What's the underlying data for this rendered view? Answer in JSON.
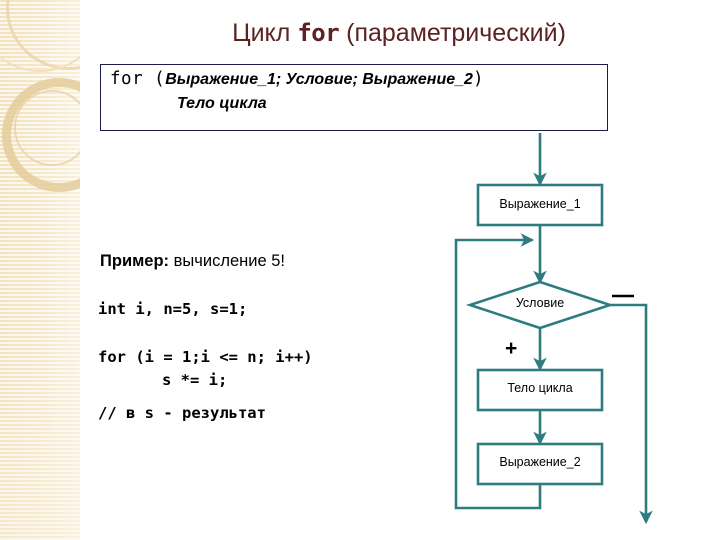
{
  "slide": {
    "title": {
      "prefix": "Цикл ",
      "keyword": "for",
      "suffix": " (параметрический)"
    },
    "syntax_box": {
      "line1_keyword": "for (",
      "line1_italic": "Выражение_1; Условие; Выражение_2",
      "line1_close": ")",
      "line2": "Тело цикла"
    },
    "example": {
      "lead": "Пример:",
      "rest": " вычисление 5!",
      "code": [
        "int i, n=5, s=1;",
        "for (i = 1;i <= n; i++)",
        "s *= i;",
        "// в s - результат"
      ]
    },
    "flowchart": {
      "nodes": [
        {
          "id": "expr1",
          "shape": "rect",
          "label": "Выражение_1"
        },
        {
          "id": "cond",
          "shape": "diamond",
          "label": "Условие"
        },
        {
          "id": "body",
          "shape": "rect",
          "label": "Тело цикла"
        },
        {
          "id": "expr2",
          "shape": "rect",
          "label": "Выражение_2"
        }
      ],
      "branch_true_sign": "+",
      "branch_false_sign": "−"
    },
    "colors": {
      "title_text": "#5b2323",
      "box_border": "#1b1b4a",
      "flow_stroke": "#2f7c80",
      "sidebar_bg": "#f4e4c2",
      "page_bg": "#ffffff"
    }
  }
}
